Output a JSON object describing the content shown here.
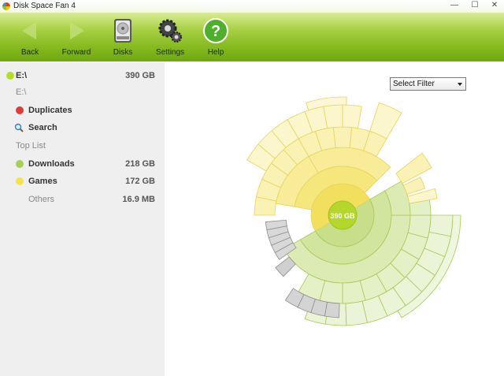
{
  "window": {
    "title": "Disk Space Fan 4",
    "minimize_glyph": "—",
    "maximize_glyph": "☐",
    "close_glyph": "✕"
  },
  "toolbar": {
    "back_label": "Back",
    "forward_label": "Forward",
    "disks_label": "Disks",
    "settings_label": "Settings",
    "help_label": "Help"
  },
  "sidebar": {
    "drive": {
      "label": "E:\\",
      "size": "390 GB",
      "color": "#b3dd27"
    },
    "path": "E:\\",
    "duplicates": {
      "label": "Duplicates",
      "color": "#e03b3b"
    },
    "search": {
      "label": "Search"
    },
    "top_list_heading": "Top List",
    "top_list": [
      {
        "label": "Downloads",
        "size": "218 GB",
        "color": "#a6d05a"
      },
      {
        "label": "Games",
        "size": "172 GB",
        "color": "#f2e44a"
      },
      {
        "label": "Others",
        "size": "16.9 MB"
      }
    ]
  },
  "main": {
    "filter": {
      "selected": "Select Filter"
    },
    "center_label": "390 GB"
  },
  "colors": {
    "toolbar_green": "#86ba20",
    "green_ring": "#b8d96e",
    "yellow_ring": "#f7e680",
    "gray_segment": "#d2d2d2"
  },
  "icons": {
    "back": "arrow-left-icon",
    "forward": "arrow-right-icon",
    "disks": "hard-disk-icon",
    "settings": "gears-icon",
    "help": "question-mark-icon",
    "search": "magnifier-icon"
  }
}
